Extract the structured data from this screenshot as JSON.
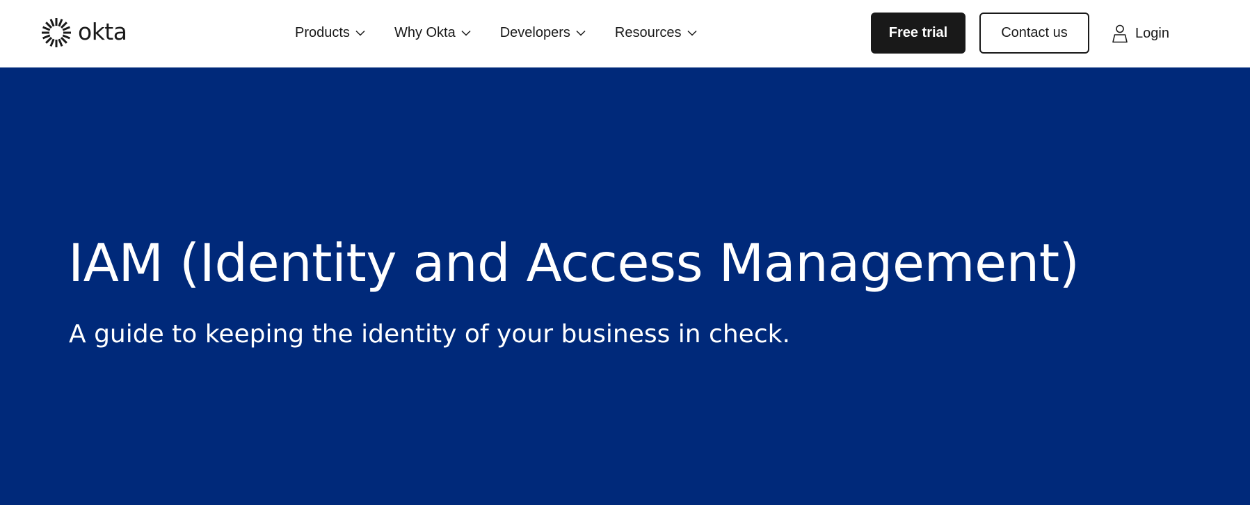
{
  "header": {
    "logo_text": "okta",
    "logo_icon": "okta-sunburst-icon",
    "nav": [
      {
        "label": "Products",
        "icon": "chevron-down-icon"
      },
      {
        "label": "Why Okta",
        "icon": "chevron-down-icon"
      },
      {
        "label": "Developers",
        "icon": "chevron-down-icon"
      },
      {
        "label": "Resources",
        "icon": "chevron-down-icon"
      }
    ],
    "free_trial_label": "Free trial",
    "contact_label": "Contact us",
    "login_label": "Login",
    "login_icon": "user-icon"
  },
  "hero": {
    "title": "IAM (Identity and Access Management)",
    "subtitle": "A guide to keeping the identity of your business in check."
  },
  "colors": {
    "hero_background": "#00297a",
    "primary_button": "#191919",
    "text_dark": "#191919",
    "text_light": "#ffffff"
  }
}
